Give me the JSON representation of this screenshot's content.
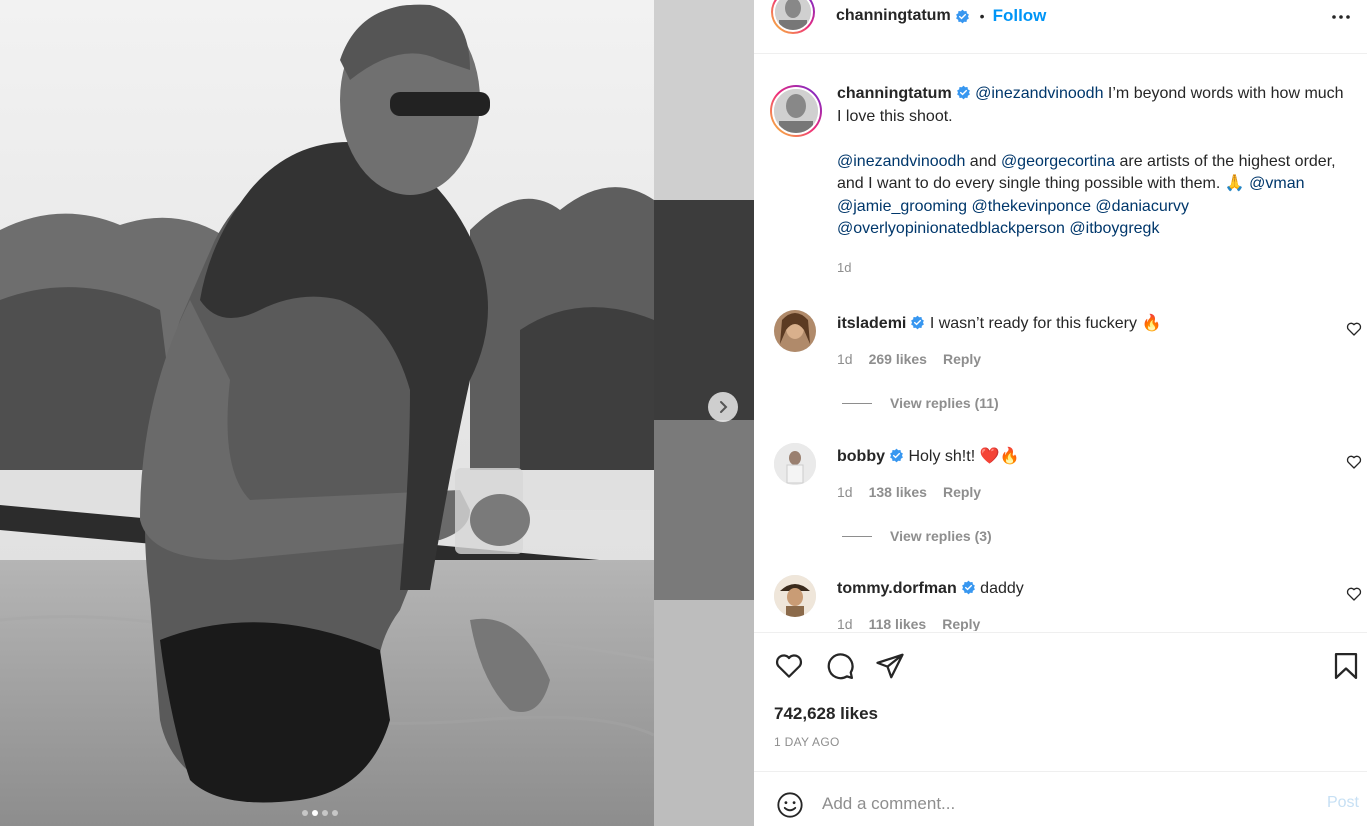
{
  "post": {
    "author": "channingtatum",
    "follow_label": "Follow",
    "bullet": "•",
    "caption": {
      "segments": [
        {
          "type": "mention",
          "text": "@inezandvinoodh"
        },
        {
          "type": "text",
          "text": " I’m beyond words with how much I love this shoot."
        },
        {
          "type": "break"
        },
        {
          "type": "mention",
          "text": "@inezandvinoodh"
        },
        {
          "type": "text",
          "text": " and "
        },
        {
          "type": "mention",
          "text": "@georgecortina"
        },
        {
          "type": "text",
          "text": " are artists of the highest order, and I want to do every single thing possible with them. 🙏 "
        },
        {
          "type": "mention",
          "text": "@vman"
        },
        {
          "type": "text",
          "text": " "
        },
        {
          "type": "mention",
          "text": "@jamie_grooming"
        },
        {
          "type": "text",
          "text": " "
        },
        {
          "type": "mention",
          "text": "@thekevinponce"
        },
        {
          "type": "text",
          "text": " "
        },
        {
          "type": "mention",
          "text": "@daniacurvy"
        },
        {
          "type": "text",
          "text": " "
        },
        {
          "type": "mention",
          "text": "@overlyopinionatedblackperson"
        },
        {
          "type": "text",
          "text": " "
        },
        {
          "type": "mention",
          "text": "@itboygregk"
        }
      ],
      "time": "1d"
    },
    "likes": "742,628 likes",
    "posted": "1 DAY AGO",
    "carousel": {
      "count": 4,
      "active_index": 1
    }
  },
  "comments": [
    {
      "user": "itslademi",
      "text": "I wasn’t ready for this fuckery 🔥",
      "time": "1d",
      "likes": "269 likes",
      "reply": "Reply",
      "view_replies": "View replies (11)"
    },
    {
      "user": "bobby",
      "text": "Holy sh!t! ❤️🔥",
      "time": "1d",
      "likes": "138 likes",
      "reply": "Reply",
      "view_replies": "View replies (3)"
    },
    {
      "user": "tommy.dorfman",
      "text": "daddy",
      "time": "1d",
      "likes": "118 likes",
      "reply": "Reply"
    }
  ],
  "composer": {
    "placeholder": "Add a comment...",
    "post_label": "Post"
  },
  "icons": {
    "like": "heart-icon",
    "comment": "comment-bubble-icon",
    "share": "paper-plane-icon",
    "save": "bookmark-icon",
    "emoji": "smiley-icon",
    "more": "more-horizontal-icon",
    "verified": "verified-badge-icon",
    "next": "chevron-right-icon"
  },
  "colors": {
    "link": "#00376b",
    "follow": "#0095f6",
    "verified": "#3897f0",
    "muted": "#8e8e8e"
  }
}
